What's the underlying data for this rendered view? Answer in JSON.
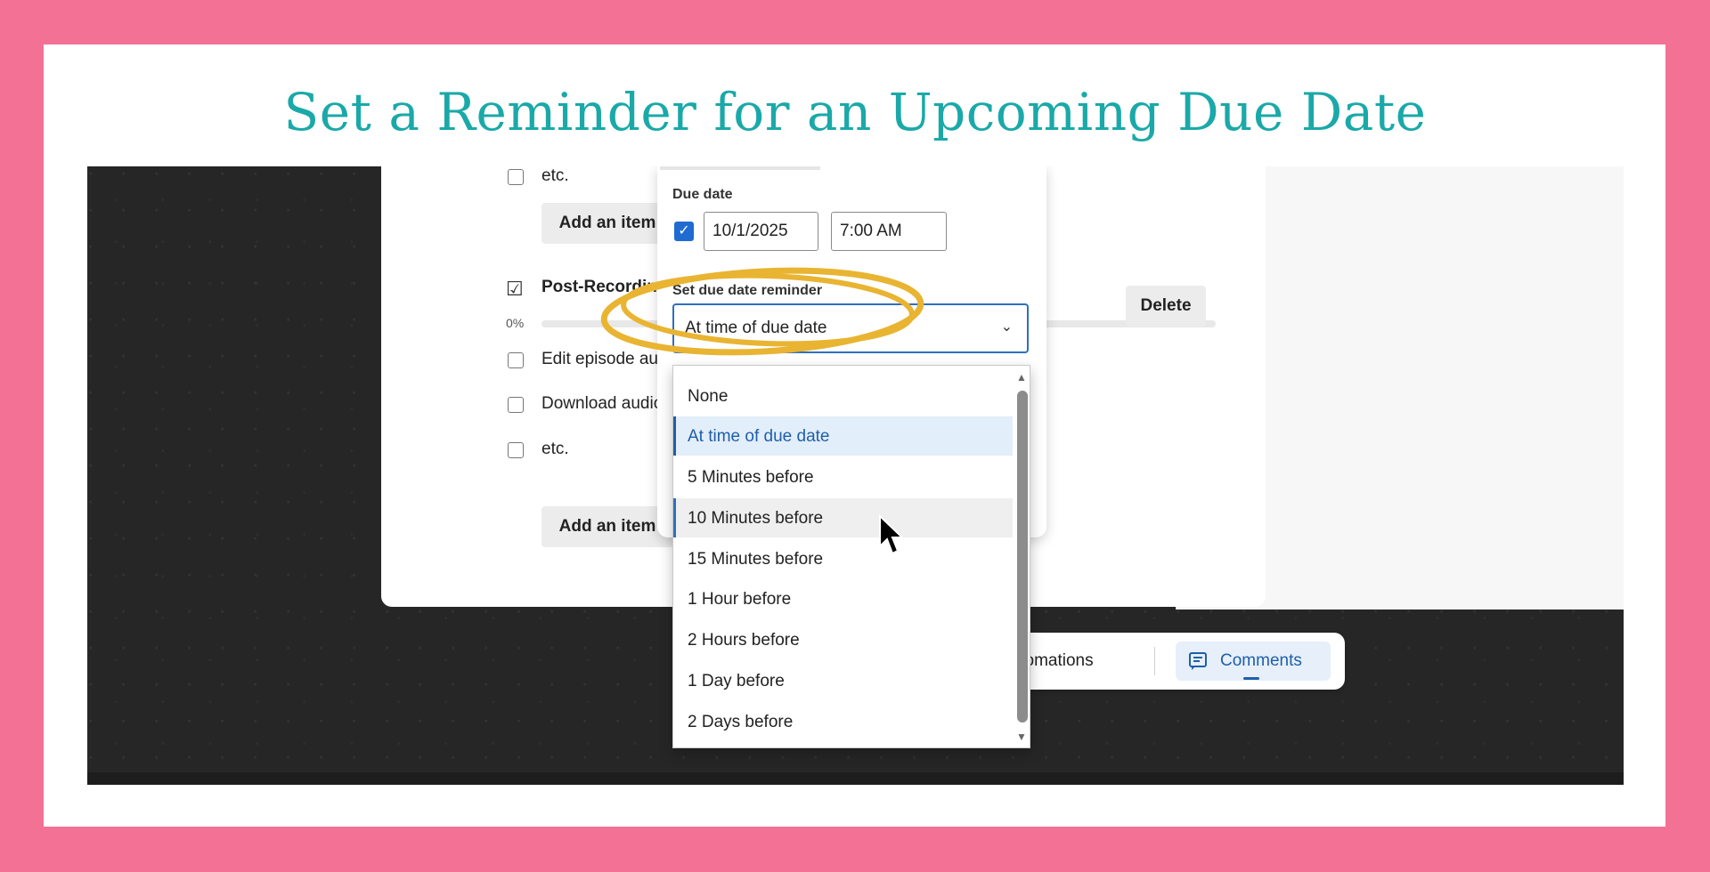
{
  "colors": {
    "border_pink": "#f37194",
    "title_teal": "#1aa9a8",
    "accent_blue": "#1f6bd1",
    "highlight_gold": "#e9b431"
  },
  "title": "Set a Reminder for an Upcoming Due Date",
  "checklist_top": {
    "item_label": "etc.",
    "add_item_label": "Add an item"
  },
  "checklist": {
    "title": "Post-Recording Ta",
    "progress_text": "0%",
    "progress_value": 0,
    "items": [
      "Edit episode audio",
      "Download audio file",
      "etc."
    ],
    "add_item_label": "Add an item",
    "delete_label": "Delete"
  },
  "due_date": {
    "label": "Due date",
    "checked": true,
    "date_value": "10/1/2025",
    "time_value": "7:00 AM"
  },
  "reminder": {
    "label": "Set due date reminder",
    "selected": "At time of due date",
    "options": [
      "None",
      "At time of due date",
      "5 Minutes before",
      "10 Minutes before",
      "15 Minutes before",
      "1 Hour before",
      "2 Hours before",
      "1 Day before",
      "2 Days before"
    ]
  },
  "toolbar": {
    "automations_label": "Automations",
    "comments_label": "Comments",
    "comments_icon": "comment-icon"
  }
}
